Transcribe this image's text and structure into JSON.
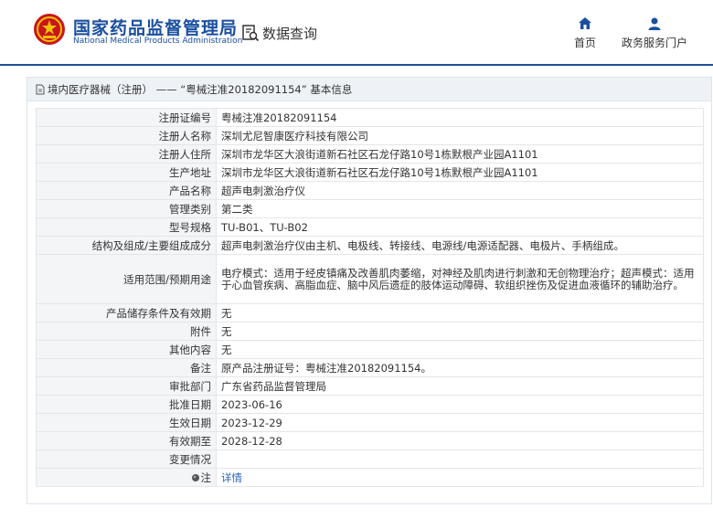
{
  "header": {
    "org_cn": "国家药品监督管理局",
    "org_en": "National Medical Products Administration",
    "data_query": "数据查询",
    "nav_home": "首页",
    "nav_portal": "政务服务门户"
  },
  "colors": {
    "brand": "#1a4fa0",
    "header_line": "#1f4e9a",
    "link": "#2b63b8",
    "label_bg": "#f3f5f7"
  },
  "panel": {
    "title": "境内医疗器械（注册） ——  “粤械注准20182091154”  基本信息"
  },
  "rows": [
    {
      "label": "注册证编号",
      "value": "粤械注准20182091154"
    },
    {
      "label": "注册人名称",
      "value": "深圳尤尼智康医疗科技有限公司"
    },
    {
      "label": "注册人住所",
      "value": "深圳市龙华区大浪街道新石社区石龙仔路10号1栋默根产业园A1101"
    },
    {
      "label": "生产地址",
      "value": "深圳市龙华区大浪街道新石社区石龙仔路10号1栋默根产业园A1101"
    },
    {
      "label": "产品名称",
      "value": "超声电刺激治疗仪"
    },
    {
      "label": "管理类别",
      "value": "第二类"
    },
    {
      "label": "型号规格",
      "value": "TU-B01、TU-B02"
    },
    {
      "label": "结构及组成/主要组成成分",
      "value": "超声电刺激治疗仪由主机、电极线、转接线、电源线/电源适配器、电极片、手柄组成。"
    },
    {
      "label": "适用范围/预期用途",
      "value": "电疗模式：适用于经皮镇痛及改善肌肉萎缩，对神经及肌肉进行刺激和无创物理治疗；超声模式：适用于心血管疾病、高脂血症、脑中风后遗症的肢体运动障碍、软组织挫伤及促进血液循环的辅助治疗。"
    },
    {
      "label": "产品储存条件及有效期",
      "value": "无"
    },
    {
      "label": "附件",
      "value": "无"
    },
    {
      "label": "其他内容",
      "value": "无"
    },
    {
      "label": "备注",
      "value": "原产品注册证号：粤械注准20182091154。"
    },
    {
      "label": "审批部门",
      "value": "广东省药品监督管理局"
    },
    {
      "label": "批准日期",
      "value": "2023-06-16"
    },
    {
      "label": "生效日期",
      "value": "2023-12-29"
    },
    {
      "label": "有效期至",
      "value": "2028-12-28"
    },
    {
      "label": "变更情况",
      "value": ""
    }
  ],
  "note": {
    "label": "注",
    "link": "详情",
    "icon": "pin-icon"
  }
}
